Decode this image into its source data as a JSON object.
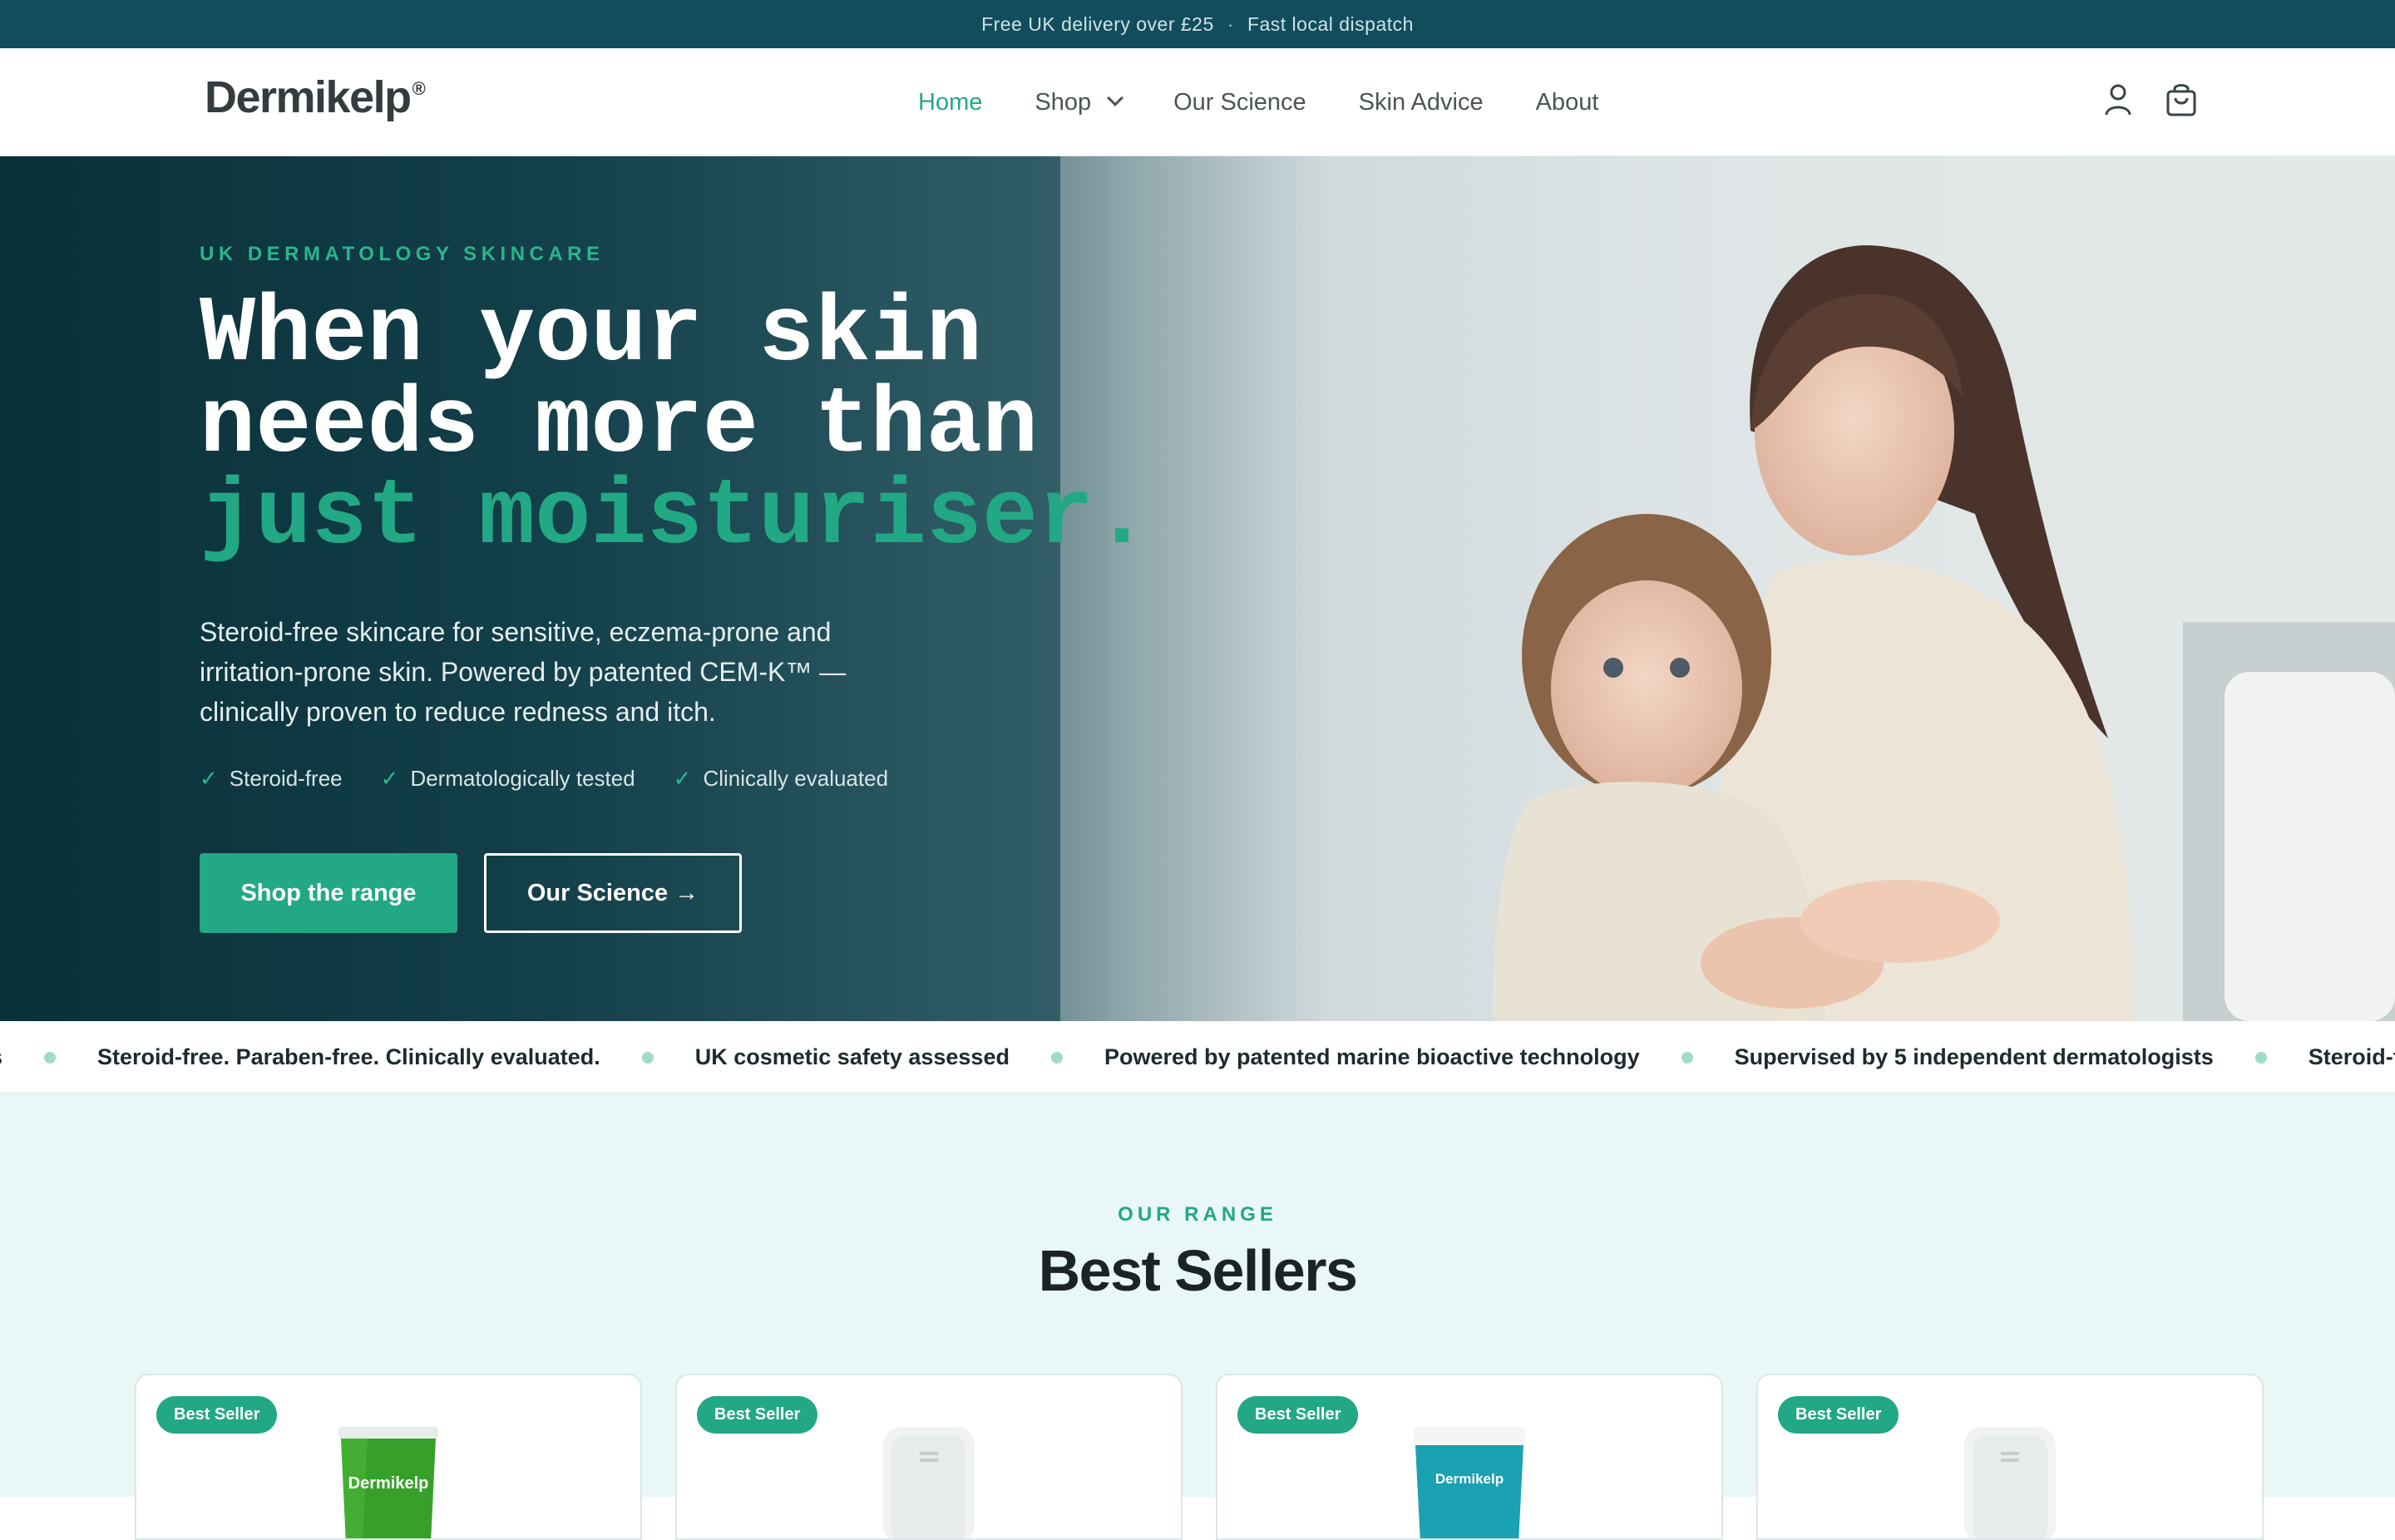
{
  "announcement": {
    "left": "Free UK delivery over £25",
    "separator": "·",
    "right": "Fast local dispatch"
  },
  "header": {
    "logo": "Dermikelp",
    "logo_mark": "®",
    "nav": [
      {
        "label": "Home",
        "active": true
      },
      {
        "label": "Shop",
        "has_dropdown": true
      },
      {
        "label": "Our Science"
      },
      {
        "label": "Skin Advice"
      },
      {
        "label": "About"
      }
    ],
    "icons": [
      "account-icon",
      "cart-icon"
    ]
  },
  "hero": {
    "eyebrow": "UK DERMATOLOGY SKINCARE",
    "headline_line1": "When your skin",
    "headline_line2": "needs more than",
    "headline_accent": "just moisturiser.",
    "subcopy": "Steroid-free skincare for sensitive, eczema-prone and irritation-prone skin. Powered by patented CEM-K™ — clinically proven to reduce redness and itch.",
    "checks": [
      "Steroid-free",
      "Dermatologically tested",
      "Clinically evaluated"
    ],
    "check_glyph": "✓",
    "primary_cta": "Shop the range",
    "secondary_cta": "Our Science →"
  },
  "ticker": {
    "items": [
      "s",
      "Steroid-free. Paraben-free. Clinically evaluated.",
      "UK cosmetic safety assessed",
      "Powered by patented marine bioactive technology",
      "Supervised by 5 independent dermatologists",
      "Steroid-free. Paraben-free. Clinically evaluated."
    ]
  },
  "range": {
    "eyebrow": "OUR RANGE",
    "title": "Best Sellers",
    "products": [
      {
        "badge": "Best Seller",
        "package": "green-tube",
        "brand": "Dermikelp"
      },
      {
        "badge": "Best Seller",
        "package": "white-pump"
      },
      {
        "badge": "Best Seller",
        "package": "teal-tube",
        "brand": "Dermikelp"
      },
      {
        "badge": "Best Seller",
        "package": "white-pump"
      }
    ]
  },
  "colors": {
    "brand_teal": "#114d5d",
    "accent_green": "#22a884",
    "section_bg": "#e9f7f6"
  }
}
